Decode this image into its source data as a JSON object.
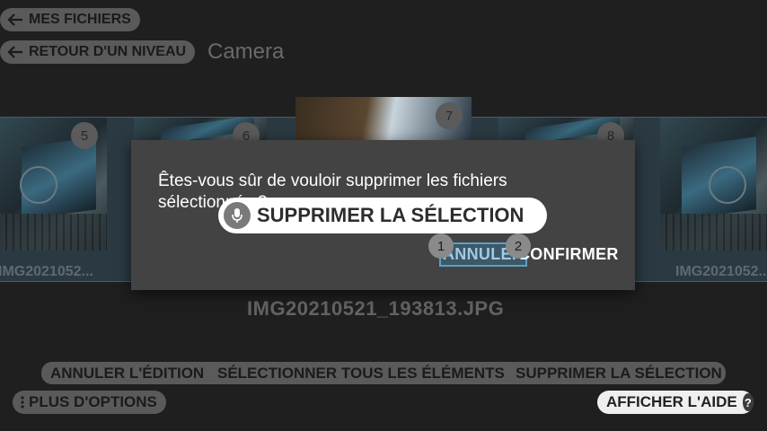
{
  "nav": {
    "my_files": "MES FICHIERS",
    "up_one_level": "RETOUR D'UN NIVEAU",
    "folder": "Camera"
  },
  "thumbnails": [
    {
      "index": "5",
      "name": "IMG2021052..."
    },
    {
      "index": "6",
      "name": ""
    },
    {
      "index": "7",
      "name": ""
    },
    {
      "index": "8",
      "name": ""
    },
    {
      "index": "",
      "name": "IMG2021052..."
    }
  ],
  "current_file": "IMG20210521_193813.JPG",
  "dialog": {
    "message": "Êtes-vous sûr de vouloir supprimer les fichiers sélectionnés ?",
    "cancel": "ANNULER",
    "confirm": "CONFIRMER",
    "cancel_badge": "1",
    "confirm_badge": "2"
  },
  "voice_command": "SUPPRIMER LA SÉLECTION",
  "bottom_bar": {
    "cancel_edit": "ANNULER L'ÉDITION",
    "select_all": "SÉLECTIONNER TOUS LES ÉLÉMENTS",
    "delete_selection": "SUPPRIMER LA SÉLECTION",
    "more_options": "PLUS D'OPTIONS",
    "show_help": "AFFICHER L'AIDE",
    "help_glyph": "?"
  },
  "colors": {
    "background": "#1f1f1f",
    "dialog": "#434343",
    "highlight": "#5aa0c8"
  }
}
